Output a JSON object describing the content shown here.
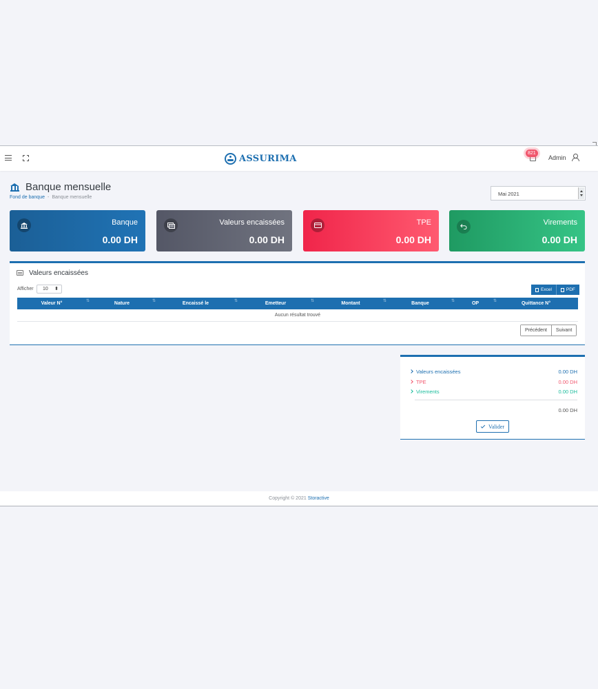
{
  "header": {
    "brand": "ASSURIMA",
    "notification_count": "821",
    "user_name": "Admin"
  },
  "page": {
    "title": "Banque mensuelle",
    "breadcrumb": [
      "Fond de banque",
      "Banque mensuelle"
    ],
    "period": "Mai 2021"
  },
  "cards": [
    {
      "title": "Banque",
      "value": "0.00 DH",
      "color": "#2073b5"
    },
    {
      "title": "Valeurs encaissées",
      "value": "0.00 DH",
      "color": "#5f6270"
    },
    {
      "title": "TPE",
      "value": "0.00 DH",
      "color": "#f83a5b"
    },
    {
      "title": "Virements",
      "value": "0.00 DH",
      "color": "#2eb37a"
    }
  ],
  "table_panel": {
    "title": "Valeurs encaissées",
    "show_label": "Afficher",
    "page_size": "10",
    "export": {
      "excel": "Excel",
      "pdf": "PDF"
    },
    "columns": [
      "Valeur N°",
      "Nature",
      "Encaissé le",
      "Emetteur",
      "Montant",
      "Banque",
      "OP",
      "Quittance N°"
    ],
    "empty_message": "Aucun résultat trouvé",
    "pager": {
      "prev": "Précédent",
      "next": "Suivant"
    }
  },
  "summary": {
    "rows": [
      {
        "label": "Valeurs encaissées",
        "value": "0.00 DH",
        "color": "#1d6fb0"
      },
      {
        "label": "TPE",
        "value": "0.00 DH",
        "color": "#f1556c"
      },
      {
        "label": "Virements",
        "value": "0.00 DH",
        "color": "#1abc9c"
      }
    ],
    "total": "0.00 DH",
    "validate_label": "Valider"
  },
  "footer": {
    "copyright": "Copyright © 2021",
    "company": "Storactive"
  },
  "colors": {
    "primary": "#1d6fb0",
    "danger": "#f1556c",
    "success": "#1abc9c"
  }
}
